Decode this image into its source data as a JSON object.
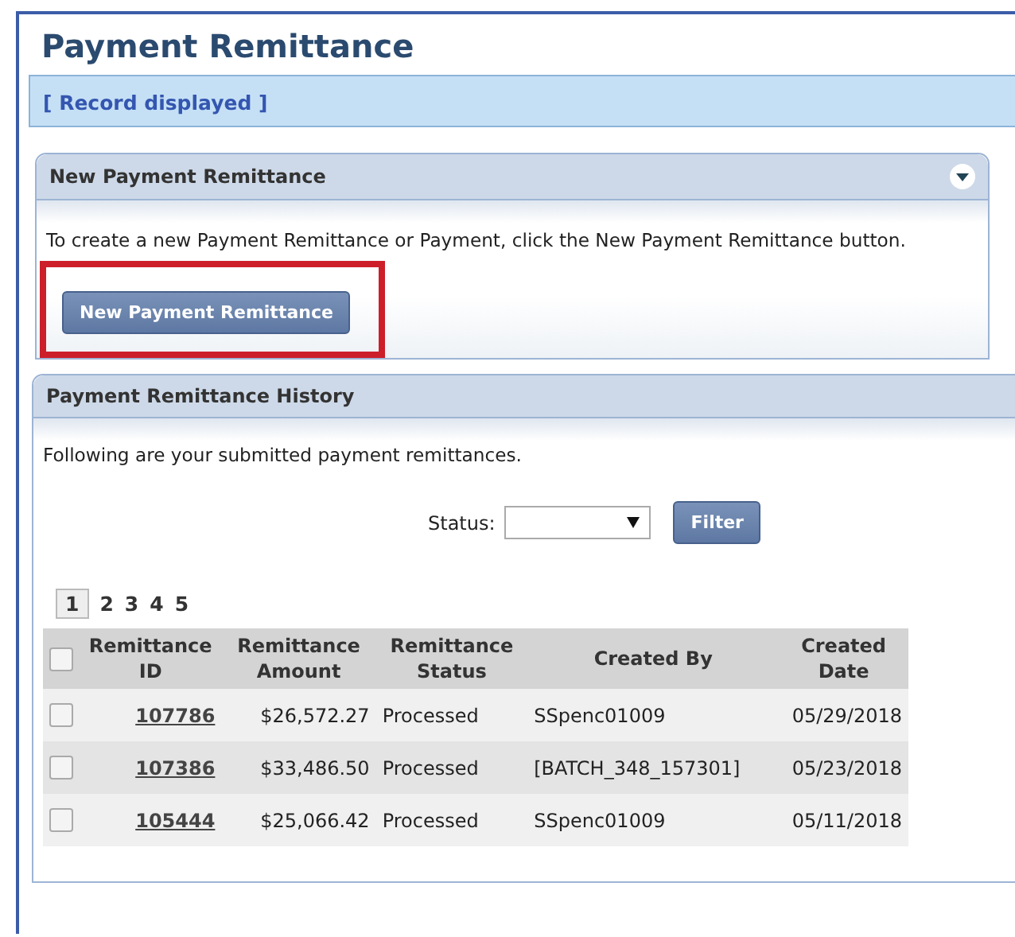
{
  "page_title": "Payment Remittance",
  "record_bar": {
    "text": "[ Record displayed ]"
  },
  "new_panel": {
    "title": "New Payment Remittance",
    "expanded": true,
    "instruction": "To create a new Payment Remittance or Payment, click the New Payment Remittance button.",
    "button": "New Payment Remittance",
    "highlighted": true
  },
  "history_panel": {
    "title": "Payment Remittance History",
    "intro": "Following are your submitted payment remittances.",
    "status_label": "Status:",
    "filter_button": "Filter",
    "pages": [
      {
        "label": "1",
        "selected": true
      },
      {
        "label": "2",
        "selected": false
      },
      {
        "label": "3",
        "selected": false
      },
      {
        "label": "4",
        "selected": false
      },
      {
        "label": "5",
        "selected": false
      }
    ],
    "table": {
      "columns": [
        "Remittance ID",
        "Remittance Amount",
        "Remittance Status",
        "Created By",
        "Created Date"
      ],
      "all_checked": false,
      "rows": [
        {
          "checked": false,
          "cells": [
            "107786",
            "$26,572.27",
            "Processed",
            "SSpenc01009",
            "05/29/2018"
          ]
        },
        {
          "checked": false,
          "cells": [
            "107386",
            "$33,486.50",
            "Processed",
            "[BATCH_348_157301]",
            "05/23/2018"
          ]
        },
        {
          "checked": false,
          "cells": [
            "105444",
            "$25,066.42",
            "Processed",
            "SSpenc01009",
            "05/11/2018"
          ]
        }
      ]
    }
  }
}
